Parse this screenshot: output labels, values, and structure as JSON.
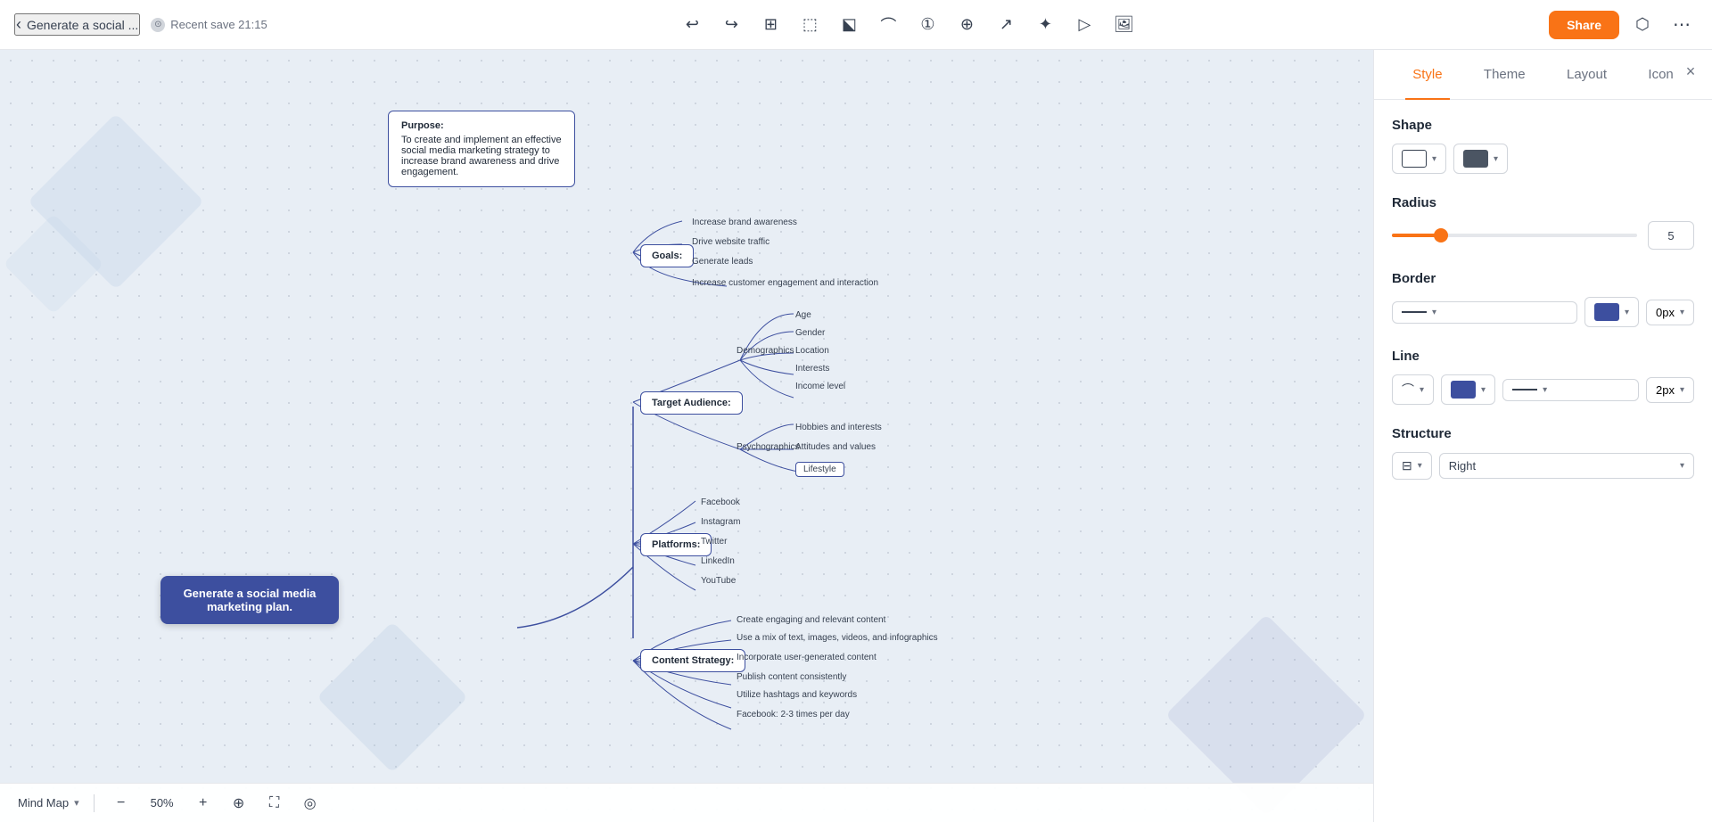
{
  "header": {
    "back_label": "Generate a social ...",
    "save_label": "Recent save 21:15",
    "share_label": "Share"
  },
  "toolbar": {
    "tools": [
      "undo",
      "redo",
      "frames",
      "selection",
      "pointer",
      "connector",
      "add-shape",
      "plus",
      "arrow",
      "star",
      "present",
      "image"
    ]
  },
  "canvas": {
    "main_node": "Generate a social media marketing plan.",
    "purpose_title": "Purpose:",
    "purpose_text": "To create and implement an effective social media marketing strategy to increase brand awareness and drive engagement.",
    "goals_node": "Goals:",
    "goals_items": [
      "Increase brand awareness",
      "Drive website traffic",
      "Generate leads",
      "Increase customer engagement and interaction"
    ],
    "target_node": "Target Audience:",
    "demographics_label": "Demographics",
    "demographics_items": [
      "Age",
      "Gender",
      "Location",
      "Interests",
      "Income level"
    ],
    "psychographics_label": "Psychographics",
    "psychographics_items": [
      "Hobbies and interests",
      "Attitudes and values",
      "Lifestyle"
    ],
    "platforms_node": "Platforms:",
    "platforms_items": [
      "Facebook",
      "Instagram",
      "Twitter",
      "LinkedIn",
      "YouTube"
    ],
    "content_node": "Content Strategy:",
    "content_items": [
      "Create engaging and relevant content",
      "Use a mix of text, images, videos, and infographics",
      "Incorporate user-generated content",
      "Publish content consistently",
      "Utilize hashtags and keywords"
    ],
    "frequency_items": [
      "Facebook: 2-3 times per day"
    ]
  },
  "right_panel": {
    "tabs": [
      "Style",
      "Theme",
      "Layout",
      "Icon"
    ],
    "active_tab": "Style",
    "shape_section_title": "Shape",
    "radius_section_title": "Radius",
    "radius_value": "5",
    "border_section_title": "Border",
    "border_size": "0px",
    "line_section_title": "Line",
    "line_size": "2px",
    "structure_section_title": "Structure",
    "structure_direction": "Right",
    "view_label": "Mind Map",
    "zoom_level": "50%",
    "close_label": "×"
  }
}
